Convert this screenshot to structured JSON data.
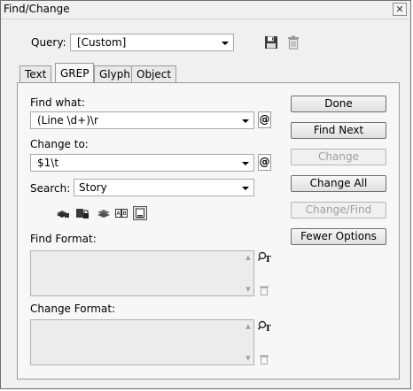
{
  "window": {
    "title": "Find/Change",
    "close_glyph": "✕"
  },
  "query": {
    "label": "Query:",
    "value": "[Custom]",
    "save_icon": "floppy-disk-icon",
    "delete_icon": "trash-icon"
  },
  "tabs": [
    {
      "label": "Text",
      "active": false
    },
    {
      "label": "GREP",
      "active": true
    },
    {
      "label": "Glyph",
      "active": false
    },
    {
      "label": "Object",
      "active": false
    }
  ],
  "find": {
    "label": "Find what:",
    "value": "(Line \\d+)\\r",
    "special_icon": "at-symbol-icon"
  },
  "change": {
    "label": "Change to:",
    "value": "$1\\t",
    "special_icon": "at-symbol-icon"
  },
  "search": {
    "label": "Search:",
    "value": "Story"
  },
  "search_options_icons": [
    "include-locked-layers-icon",
    "include-locked-stories-icon",
    "include-hidden-layers-icon",
    "include-master-pages-icon",
    "include-footnotes-icon"
  ],
  "find_format": {
    "label": "Find Format:"
  },
  "change_format": {
    "label": "Change Format:"
  },
  "buttons": {
    "done": "Done",
    "find_next": "Find Next",
    "change": "Change",
    "change_all": "Change All",
    "change_find": "Change/Find",
    "fewer_options": "Fewer Options"
  },
  "colors": {
    "window_bg": "#f0f0f0",
    "panel_bg": "#f7f7f7",
    "disabled_text": "#a0a0a0"
  }
}
